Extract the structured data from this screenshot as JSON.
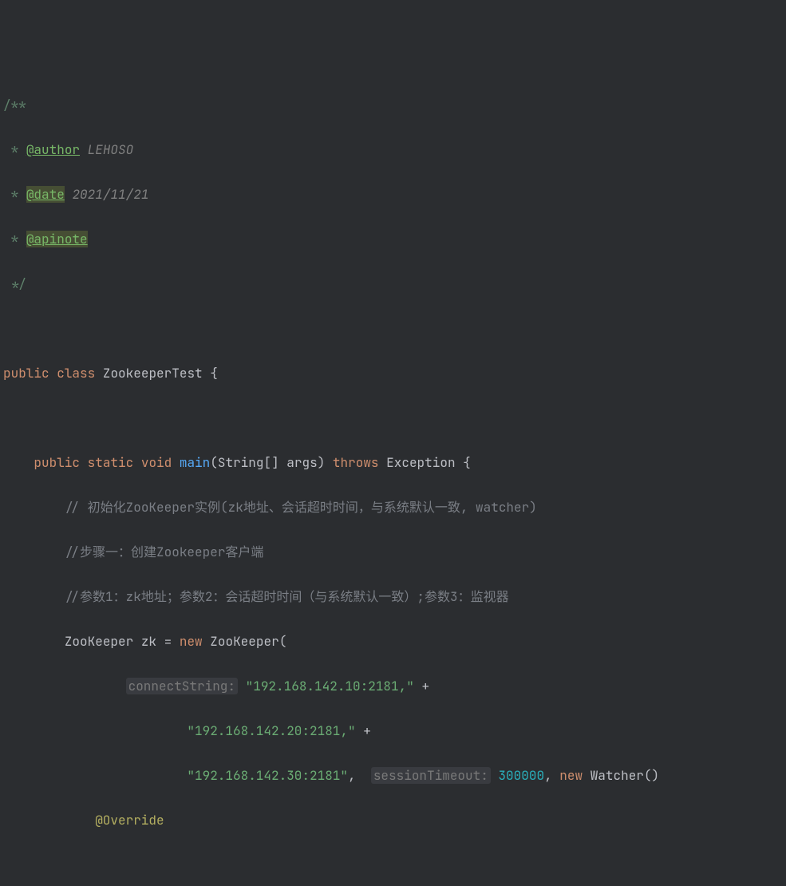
{
  "doc": {
    "l1": "/**",
    "star": " *",
    "tag_author": "@author",
    "author_val": "LEHOSO",
    "tag_date": "@date",
    "date_val": "2021/11/21",
    "tag_apinote": "@apinote",
    "l_end": " */"
  },
  "code": {
    "kw_public": "public",
    "kw_class": "class",
    "className": "ZookeeperTest",
    "brace_open": "{",
    "kw_static": "static",
    "kw_void": "void",
    "method_main": "main",
    "type_stringarr": "String[]",
    "param_args": "args",
    "kw_throws": "throws",
    "type_exception": "Exception",
    "comment1": "// 初始化ZooKeeper实例(zk地址、会话超时时间，与系统默认一致, watcher)",
    "comment2": "//步骤一：创建Zookeeper客户端",
    "comment3": "//参数1：zk地址；参数2：会话超时时间（与系统默认一致）;参数3：监视器",
    "type_zookeeper": "ZooKeeper",
    "var_zk": "zk",
    "op_eq": "=",
    "kw_new": "new",
    "ctor_zk": "ZooKeeper",
    "hint_connectString": "connectString:",
    "str1": "\"192.168.142.10:2181,\"",
    "plus": "+",
    "str2": "\"192.168.142.20:2181,\"",
    "str3": "\"192.168.142.30:2181\"",
    "comma": ",",
    "hint_sessionTimeout": "sessionTimeout:",
    "val_timeout": "300000",
    "type_watcher": "Watcher",
    "paren_close": "()",
    "anno_override": "@Override"
  }
}
